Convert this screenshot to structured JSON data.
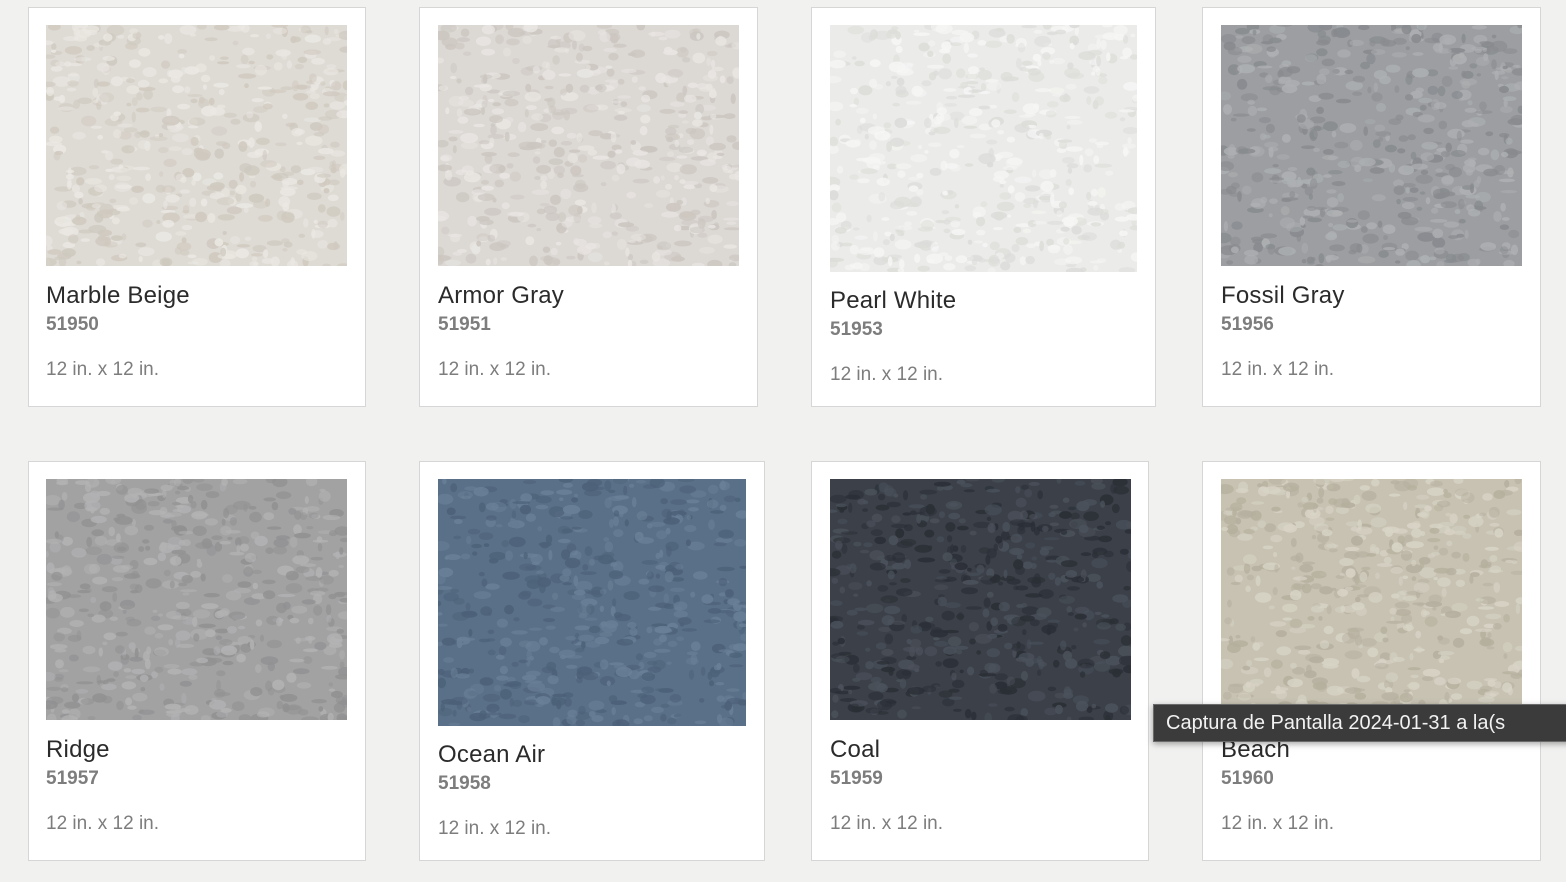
{
  "products": [
    {
      "name": "Marble Beige",
      "code": "51950",
      "size": "12 in. x 12 in.",
      "base": "#dedad4",
      "light": "#ebe8e3",
      "dark": "#cfc9bf"
    },
    {
      "name": "Armor Gray",
      "code": "51951",
      "size": "12 in. x 12 in.",
      "base": "#dcd8d4",
      "light": "#e9e6e3",
      "dark": "#ccc6c0"
    },
    {
      "name": "Pearl White",
      "code": "51953",
      "size": "12 in. x 12 in.",
      "base": "#ebebe9",
      "light": "#f6f6f5",
      "dark": "#dcdcd9"
    },
    {
      "name": "Fossil Gray",
      "code": "51956",
      "size": "12 in. x 12 in.",
      "base": "#9c9ea1",
      "light": "#aeb0b3",
      "dark": "#888a8e"
    },
    {
      "name": "Ridge",
      "code": "51957",
      "size": "12 in. x 12 in.",
      "base": "#a2a2a3",
      "light": "#b3b3b4",
      "dark": "#919192"
    },
    {
      "name": "Ocean Air",
      "code": "51958",
      "size": "12 in. x 12 in.",
      "base": "#5a7088",
      "light": "#6a8098",
      "dark": "#4c6178"
    },
    {
      "name": "Coal",
      "code": "51959",
      "size": "12 in. x 12 in.",
      "base": "#3b4049",
      "light": "#4c525b",
      "dark": "#2a2e35"
    },
    {
      "name": "Beach",
      "code": "51960",
      "size": "12 in. x 12 in.",
      "base": "#c7c2b2",
      "light": "#d8d4c6",
      "dark": "#b5af9e"
    }
  ],
  "tooltip": {
    "text": "Captura de Pantalla 2024-01-31 a la(s"
  }
}
